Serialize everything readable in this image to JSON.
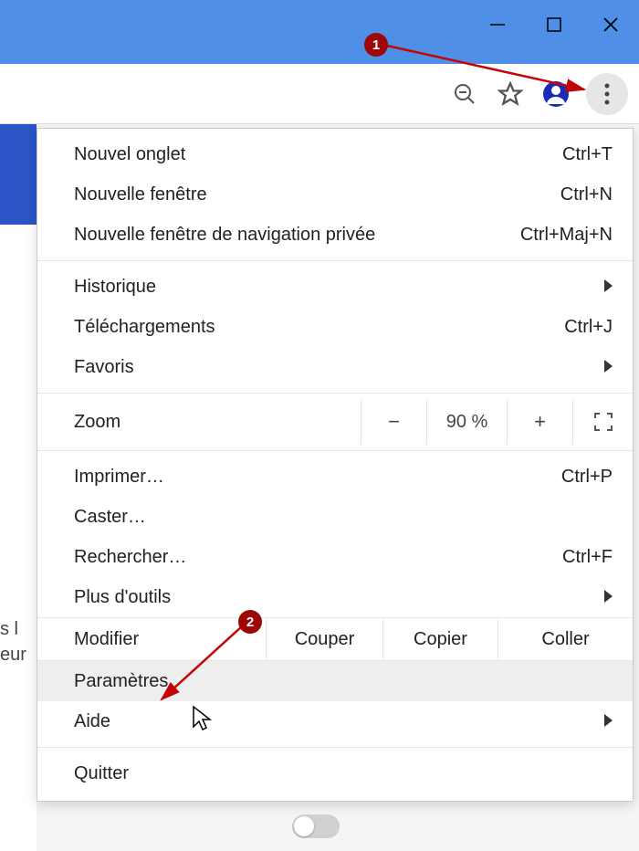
{
  "window": {
    "minimize": "minimize",
    "maximize": "maximize",
    "close": "close"
  },
  "toolbar": {
    "zoom_out": "zoom-out",
    "star": "bookmark",
    "profile": "profile",
    "menu": "menu"
  },
  "menu": {
    "new_tab": {
      "label": "Nouvel onglet",
      "shortcut": "Ctrl+T"
    },
    "new_window": {
      "label": "Nouvelle fenêtre",
      "shortcut": "Ctrl+N"
    },
    "incognito": {
      "label": "Nouvelle fenêtre de navigation privée",
      "shortcut": "Ctrl+Maj+N"
    },
    "history": {
      "label": "Historique"
    },
    "downloads": {
      "label": "Téléchargements",
      "shortcut": "Ctrl+J"
    },
    "bookmarks": {
      "label": "Favoris"
    },
    "zoom": {
      "label": "Zoom",
      "value": "90 %",
      "minus": "−",
      "plus": "+"
    },
    "print": {
      "label": "Imprimer…",
      "shortcut": "Ctrl+P"
    },
    "cast": {
      "label": "Caster…"
    },
    "find": {
      "label": "Rechercher…",
      "shortcut": "Ctrl+F"
    },
    "more_tools": {
      "label": "Plus d'outils"
    },
    "edit": {
      "label": "Modifier",
      "cut": "Couper",
      "copy": "Copier",
      "paste": "Coller"
    },
    "settings": {
      "label": "Paramètres"
    },
    "help": {
      "label": "Aide"
    },
    "quit": {
      "label": "Quitter"
    }
  },
  "page_bg": {
    "frag1": "s l",
    "frag2": "eur"
  },
  "markers": {
    "one": "1",
    "two": "2"
  },
  "toggle": {
    "state": "off"
  }
}
